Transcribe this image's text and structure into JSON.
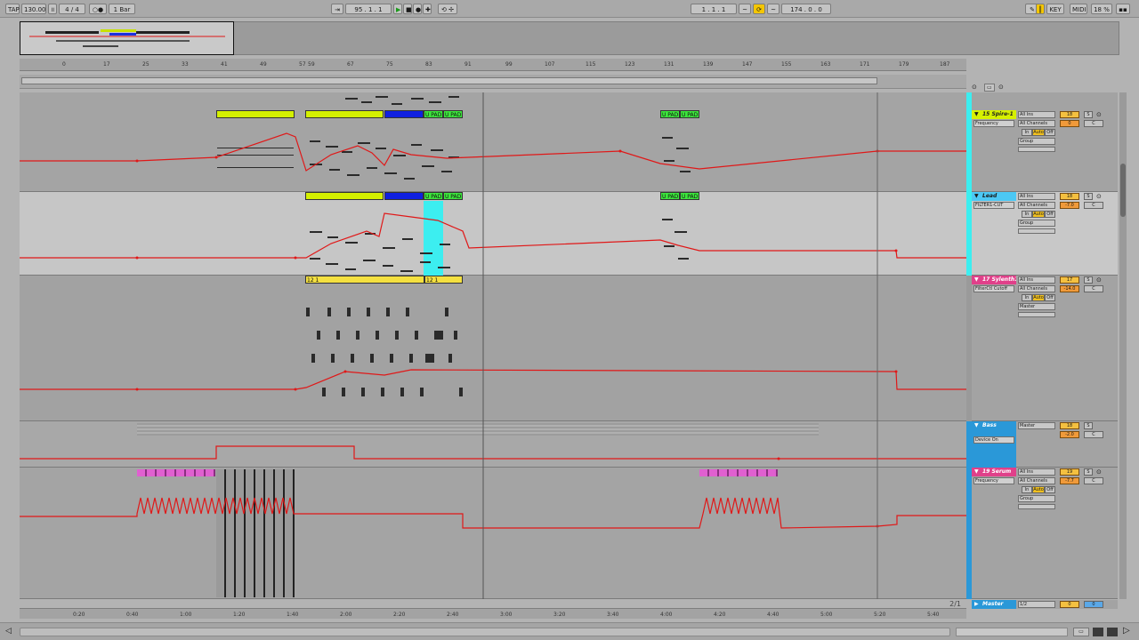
{
  "transport": {
    "tap": "TAP",
    "tempo": "130.00",
    "time_sig": "4 / 4",
    "quantize": "1 Bar",
    "position": "95 . 1 . 1",
    "loop_start": "1 . 1 . 1",
    "loop_length": "174 . 0 . 0",
    "key_label": "KEY",
    "midi_label": "MIDI",
    "cpu": "18 %"
  },
  "ruler_top": [
    "0",
    "17",
    "25",
    "33",
    "41",
    "49",
    "57",
    "59",
    "67",
    "75",
    "83",
    "91",
    "99",
    "107",
    "115",
    "123",
    "131",
    "139",
    "147",
    "155",
    "163",
    "171",
    "179",
    "187"
  ],
  "ruler_bottom": [
    "0:20",
    "0:40",
    "1:00",
    "1:20",
    "1:40",
    "2:00",
    "2:20",
    "2:40",
    "3:00",
    "3:20",
    "3:40",
    "4:00",
    "4:20",
    "4:40",
    "5:00",
    "5:20",
    "5:40"
  ],
  "clips": {
    "upad": "U PAD",
    "chain": "12 1"
  },
  "tracks": [
    {
      "name": "15 Spire-1",
      "input": "All Ins",
      "param": "Frequency",
      "channel": "All Channels",
      "in": "In",
      "auto": "Auto",
      "off": "Off",
      "group": "Group",
      "vol": "18",
      "pan": "0",
      "s": "S",
      "pan_c": "C",
      "color": "#d6f000"
    },
    {
      "name": "Lead",
      "input": "All Ins",
      "param": "FILTER1-CUT",
      "channel": "All Channels",
      "in": "In",
      "auto": "Auto",
      "off": "Off",
      "group": "Group",
      "vol": "18",
      "pan": "-7.0",
      "s": "S",
      "pan_c": "C",
      "color": "#4cc8f4"
    },
    {
      "name": "17 Sylenth1",
      "input": "All Ins",
      "param": "FilterCtl Cutoff",
      "channel": "All Channels",
      "in": "In",
      "auto": "Auto",
      "off": "Off",
      "group": "Master",
      "vol": "17",
      "pan": "-14.0",
      "s": "S",
      "pan_c": "C",
      "color": "#e0408a"
    },
    {
      "name": "Bass",
      "input": "Master",
      "param": "Device On",
      "vol": "18",
      "pan": "-2.0",
      "s": "S",
      "pan_c": "C",
      "color": "#2a98d8"
    },
    {
      "name": "19 Serum",
      "input": "All Ins",
      "param": "Frequency",
      "channel": "All Channels",
      "in": "In",
      "auto": "Auto",
      "off": "Off",
      "group": "Group",
      "vol": "19",
      "pan": "-7.7",
      "s": "S",
      "pan_c": "C",
      "color": "#e0408a"
    }
  ],
  "master": {
    "name": "Master",
    "output": "1/2",
    "vol": "0",
    "pan": "0"
  },
  "page_count": "2/1",
  "colors": {
    "automation": "#e01818",
    "lime": "#d4f000",
    "blue": "#1020e0",
    "green": "#3ce63c",
    "cyan": "#3cf0f0",
    "pink": "#e060d0",
    "yellow": "#f4e040"
  }
}
